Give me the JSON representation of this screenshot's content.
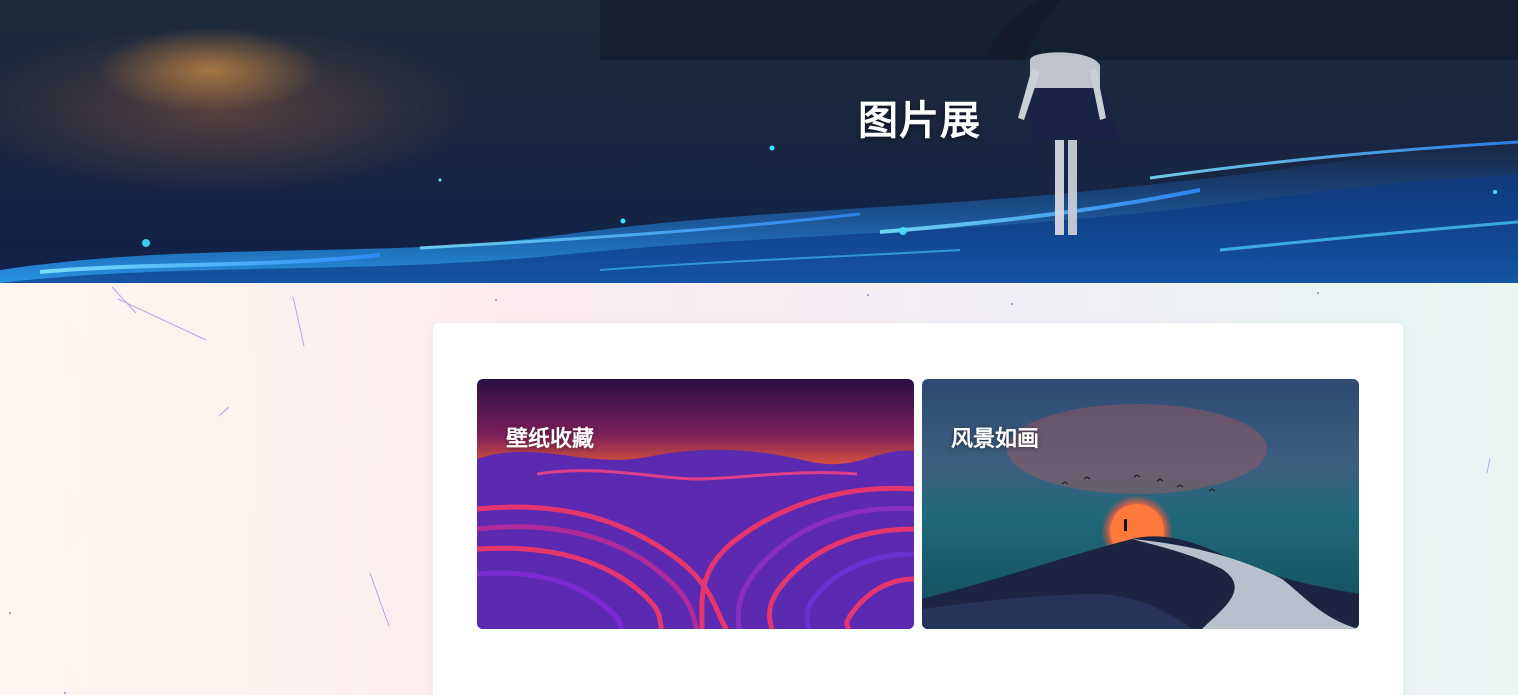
{
  "hero": {
    "title": "图片展"
  },
  "gallery": {
    "items": [
      {
        "label": "壁纸收藏"
      },
      {
        "label": "风景如画"
      }
    ]
  },
  "colors": {
    "page_bg_left": "#fff5ee",
    "page_bg_right": "#e8f6f4",
    "card_bg": "#ffffff",
    "title_text": "#ffffff"
  }
}
